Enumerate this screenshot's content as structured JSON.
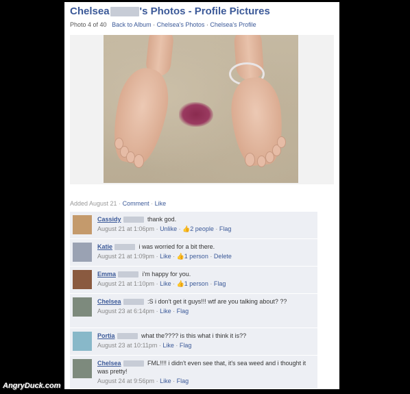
{
  "header": {
    "title_name": "Chelsea",
    "title_suffix": "'s Photos - Profile Pictures",
    "photo_count": "Photo 4 of 40",
    "back_link": "Back to Album",
    "album_link": "Chelsea's Photos",
    "profile_link": "Chelsea's Profile"
  },
  "photo": {
    "added_text": "Added August 21",
    "comment_label": "Comment",
    "like_label": "Like"
  },
  "comments": [
    {
      "name": "Cassidy",
      "text": "thank god.",
      "time": "August 21 at 1:06pm",
      "action": "Unlike",
      "likes": "2 people",
      "extra": "Flag",
      "avatar_color": "#c49a6c"
    },
    {
      "name": "Katie",
      "text": "i was worried for a bit there.",
      "time": "August 21 at 1:09pm",
      "action": "Like",
      "likes": "1 person",
      "extra": "Delete",
      "avatar_color": "#9aa2b3"
    },
    {
      "name": "Emma",
      "text": "i'm happy for you.",
      "time": "August 21 at 1:10pm",
      "action": "Like",
      "likes": "1 person",
      "extra": "Flag",
      "avatar_color": "#8a5a40"
    },
    {
      "name": "Chelsea",
      "text": ":S i don't get it guys!!! wtf are you talking about? ??",
      "time": "August 23 at 6:14pm",
      "action": "Like",
      "likes": "",
      "extra": "Flag",
      "avatar_color": "#7d8a7d"
    },
    {
      "name": "Portia",
      "text": "what the???? is this what i think it is??",
      "time": "August 23 at 10:11pm",
      "action": "Like",
      "likes": "",
      "extra": "Flag",
      "avatar_color": "#88b8c9"
    },
    {
      "name": "Chelsea",
      "text": "FML!!!! i didn't even see that, it's sea weed and i thought it was pretty!",
      "time": "August 24 at 9:56pm",
      "action": "Like",
      "likes": "",
      "extra": "Flag",
      "avatar_color": "#7d8a7d"
    }
  ],
  "watermark": "AngryDuck.com",
  "colors": {
    "link": "#3b5998",
    "comment_bg": "#edeff4",
    "background": "#000000"
  }
}
